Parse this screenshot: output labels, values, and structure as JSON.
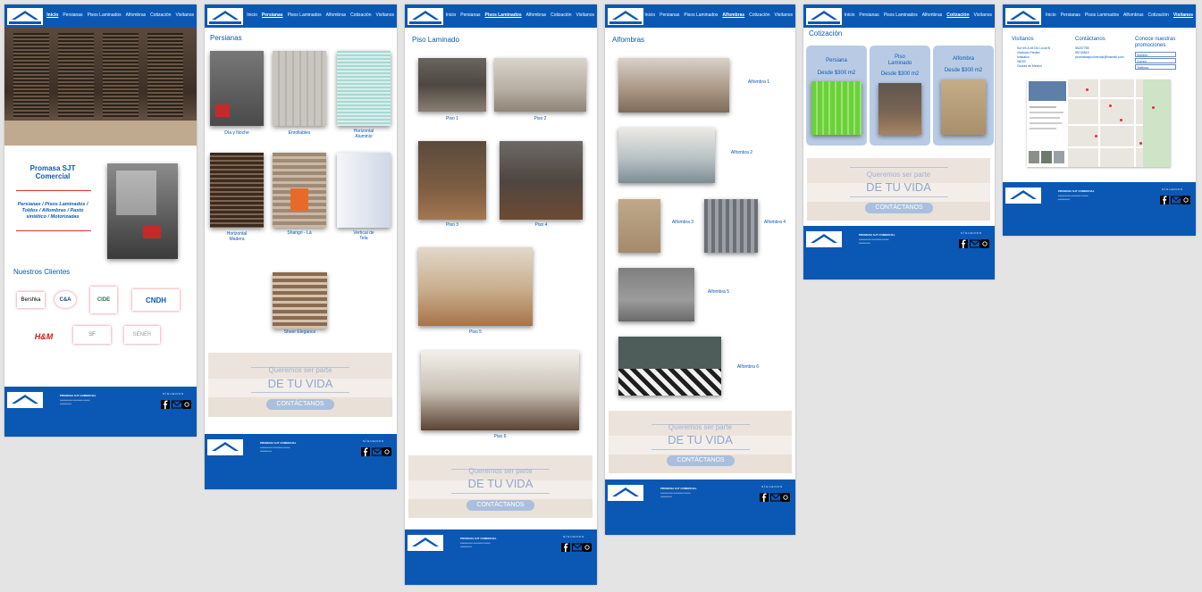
{
  "nav": [
    "Inicio",
    "Persianas",
    "Pisos Laminados",
    "Alfombras",
    "Cotización",
    "Visítanos"
  ],
  "home": {
    "promo_title": "Promasa SJT Comercial",
    "promo_text": "Persianas / Pisos Laminados / Toldos / Alfombras / Pasto sintético / Motorizadas",
    "clients_title": "Nuestros Clientes",
    "clients": [
      "Bershka",
      "C&A",
      "CIDE",
      "CNDH",
      "H&M",
      "SF",
      "SENER"
    ]
  },
  "persianas": {
    "title": "Persianas",
    "items": [
      "Día y Noche",
      "Enrollables",
      "Horizontal Aluminio",
      "Horizontal Madera",
      "Shangri - Lá",
      "Vertical de Tela",
      "Sheer Elegance"
    ]
  },
  "piso": {
    "title": "Piso Laminado",
    "items": [
      "Piso 1",
      "Piso 2",
      "Piso 3",
      "Piso 4",
      "Piso 5",
      "Piso 6"
    ]
  },
  "alfombras": {
    "title": "Alfombras",
    "items": [
      "Alfombra 1",
      "Alfombra 2",
      "Alfombra 3",
      "Alfombra 4",
      "Alfombra 5",
      "Alfombra 6"
    ]
  },
  "cotizacion": {
    "title": "Cotización",
    "cards": [
      {
        "name": "Persiana",
        "price": "Desde $300 m2"
      },
      {
        "name": "Piso Laminado",
        "price": "Desde $300 m2"
      },
      {
        "name": "Alfombra",
        "price": "Desde $300 m2"
      }
    ]
  },
  "banner": {
    "line1": "Queremos ser parte",
    "line2": "DE TU VIDA",
    "button": "CONTÁCTANOS"
  },
  "visitanos": {
    "h1": "Visítanos",
    "address": [
      "Sur 69-A #4744 Local B",
      "Viaducto Piedad",
      "Iztacalco",
      "08200",
      "Ciudad de México"
    ],
    "h2": "Contáctanos",
    "contact": [
      "55207785",
      "55740843",
      "promasasjtcomercial@hotmail.com"
    ],
    "h3": "Conoce nuestras promociones",
    "fields": [
      "Nombre",
      "Correo",
      "Teléfono"
    ]
  },
  "footer": {
    "heading": "PROMASA SJT COMERCIAL",
    "social_label": "SÍGUENOS"
  },
  "colors": {
    "brand": "#0b58b4",
    "accent": "#d33333"
  }
}
